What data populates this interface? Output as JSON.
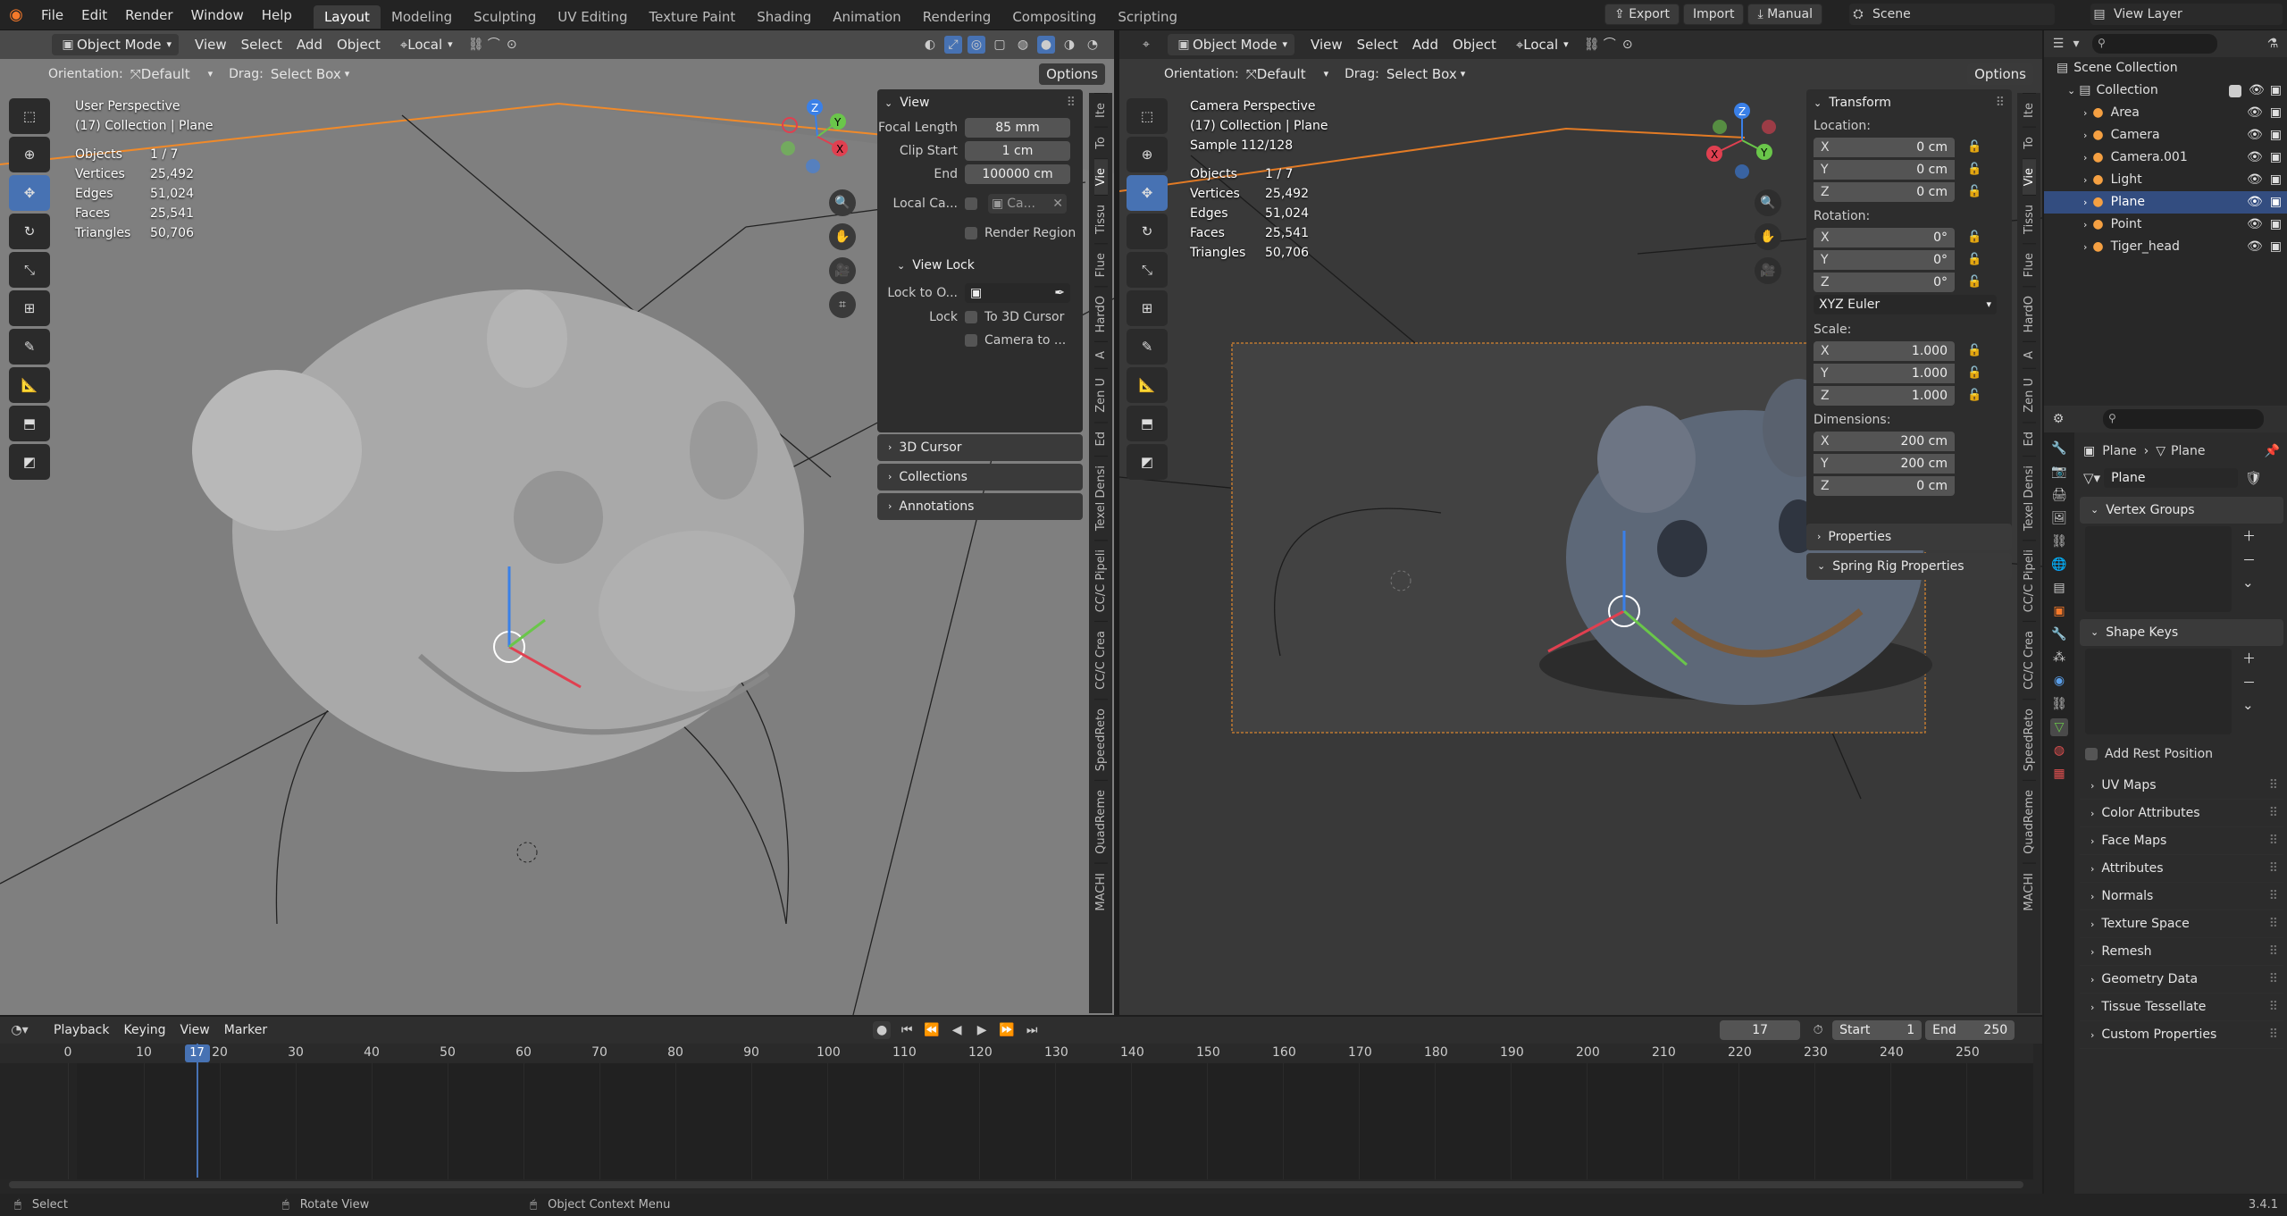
{
  "topbar": {
    "menus": [
      "File",
      "Edit",
      "Render",
      "Window",
      "Help"
    ],
    "workspaces": [
      "Layout",
      "Modeling",
      "Sculpting",
      "UV Editing",
      "Texture Paint",
      "Shading",
      "Animation",
      "Rendering",
      "Compositing",
      "Scripting"
    ],
    "active_workspace": "Layout",
    "export_label": "Export",
    "import_label": "Import",
    "manual_label": "Manual",
    "scene": "Scene",
    "view_layer": "View Layer"
  },
  "left_vp": {
    "mode": "Object Mode",
    "menus": [
      "View",
      "Select",
      "Add",
      "Object"
    ],
    "transform": "Local",
    "orientation_label": "Orientation:",
    "orientation_value": "Default",
    "drag_label": "Drag:",
    "drag_value": "Select Box",
    "options": "Options",
    "title": "User Perspective",
    "subtitle": "(17) Collection | Plane",
    "stats": [
      [
        "Objects",
        "1 / 7"
      ],
      [
        "Vertices",
        "25,492"
      ],
      [
        "Edges",
        "51,024"
      ],
      [
        "Faces",
        "25,541"
      ],
      [
        "Triangles",
        "50,706"
      ]
    ],
    "npanel": {
      "view_header": "View",
      "focal_length_label": "Focal Length",
      "focal_length": "85 mm",
      "clip_start_label": "Clip Start",
      "clip_start": "1 cm",
      "end_label": "End",
      "end": "100000 cm",
      "local_camera_label": "Local Ca...",
      "local_camera_value": "Ca...",
      "render_region": "Render Region",
      "view_lock_header": "View Lock",
      "lock_to_object_label": "Lock to O...",
      "lock_label": "Lock",
      "to_3d_cursor": "To 3D Cursor",
      "camera_to": "Camera to ...",
      "cursor_header": "3D Cursor",
      "collections_header": "Collections",
      "annotations_header": "Annotations"
    },
    "tabs": [
      "Ite",
      "To",
      "Vie",
      "Tissu",
      "Flue",
      "HardO",
      "A",
      "Zen U",
      "Ed",
      "Texel Densi",
      "CC/C Pipeli",
      "CC/C Crea",
      "SpeedReto",
      "QuadReme",
      "MACHI"
    ]
  },
  "right_vp": {
    "mode": "Object Mode",
    "menus": [
      "View",
      "Select",
      "Add",
      "Object"
    ],
    "transform": "Local",
    "orientation_label": "Orientation:",
    "orientation_value": "Default",
    "drag_label": "Drag:",
    "drag_value": "Select Box",
    "options": "Options",
    "title": "Camera Perspective",
    "subtitle": "(17) Collection | Plane",
    "sample": "Sample 112/128",
    "stats": [
      [
        "Objects",
        "1 / 7"
      ],
      [
        "Vertices",
        "25,492"
      ],
      [
        "Edges",
        "51,024"
      ],
      [
        "Faces",
        "25,541"
      ],
      [
        "Triangles",
        "50,706"
      ]
    ],
    "transform_panel": {
      "header": "Transform",
      "location_label": "Location:",
      "location": [
        [
          "X",
          "0 cm"
        ],
        [
          "Y",
          "0 cm"
        ],
        [
          "Z",
          "0 cm"
        ]
      ],
      "rotation_label": "Rotation:",
      "rotation": [
        [
          "X",
          "0°"
        ],
        [
          "Y",
          "0°"
        ],
        [
          "Z",
          "0°"
        ]
      ],
      "rotation_mode": "XYZ Euler",
      "scale_label": "Scale:",
      "scale": [
        [
          "X",
          "1.000"
        ],
        [
          "Y",
          "1.000"
        ],
        [
          "Z",
          "1.000"
        ]
      ],
      "dimensions_label": "Dimensions:",
      "dimensions": [
        [
          "X",
          "200 cm"
        ],
        [
          "Y",
          "200 cm"
        ],
        [
          "Z",
          "0 cm"
        ]
      ],
      "properties_header": "Properties",
      "spring_header": "Spring Rig Properties"
    },
    "tabs": [
      "Ite",
      "To",
      "Vie",
      "Tissu",
      "Flue",
      "HardO",
      "A",
      "Zen U",
      "Ed",
      "Texel Densi",
      "CC/C Pipeli",
      "CC/C Crea",
      "SpeedReto",
      "QuadReme",
      "MACHI"
    ]
  },
  "outliner": {
    "root": "Scene Collection",
    "collection": "Collection",
    "items": [
      "Area",
      "Camera",
      "Camera.001",
      "Light",
      "Plane",
      "Point",
      "Tiger_head"
    ],
    "selected": "Plane"
  },
  "properties": {
    "breadcrumb_object": "Plane",
    "breadcrumb_data": "Plane",
    "data_name": "Plane",
    "vertex_groups": "Vertex Groups",
    "shape_keys": "Shape Keys",
    "add_rest_position": "Add Rest Position",
    "sections": [
      "UV Maps",
      "Color Attributes",
      "Face Maps",
      "Attributes",
      "Normals",
      "Texture Space",
      "Remesh",
      "Geometry Data",
      "Tissue Tessellate",
      "Custom Properties"
    ]
  },
  "timeline": {
    "menus": [
      "Playback",
      "Keying",
      "View",
      "Marker"
    ],
    "current_frame": "17",
    "start_label": "Start",
    "start": "1",
    "end_label": "End",
    "end": "250",
    "ticks": [
      "0",
      "10",
      "20",
      "30",
      "40",
      "50",
      "60",
      "70",
      "80",
      "90",
      "100",
      "110",
      "120",
      "130",
      "140",
      "150",
      "160",
      "170",
      "180",
      "190",
      "200",
      "210",
      "220",
      "230",
      "240",
      "250"
    ]
  },
  "statusbar": {
    "select": "Select",
    "rotate": "Rotate View",
    "context": "Object Context Menu",
    "version": "3.4.1"
  }
}
